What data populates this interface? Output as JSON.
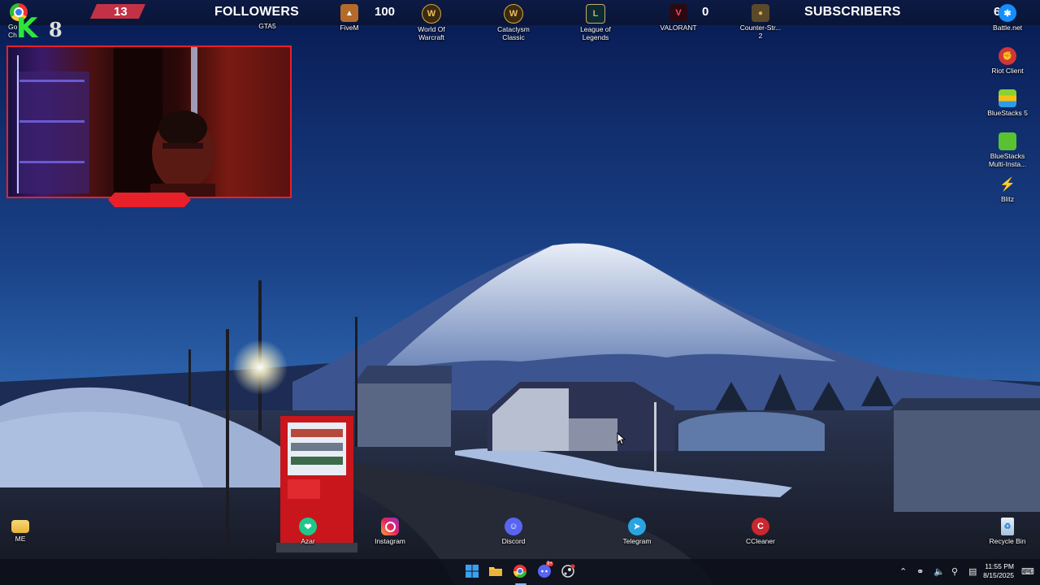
{
  "overlay": {
    "followers_count": "13",
    "followers_label": "FOLLOWERS",
    "score_100": "100",
    "score_0": "0",
    "subscribers_label": "SUBSCRIBERS",
    "subscribers_count": "6",
    "logo_letter": "K",
    "logo_number": "8"
  },
  "desktop_icons_top": [
    {
      "label": "Go\nCh",
      "icon": "chrome-icon"
    },
    {
      "label": "GTA5",
      "icon": "gta5-icon"
    },
    {
      "label": "FiveM",
      "icon": "fivem-icon"
    },
    {
      "label": "World Of\nWarcraft",
      "icon": "wow-icon"
    },
    {
      "label": "Cataclysm\nClassic",
      "icon": "wow-classic-icon"
    },
    {
      "label": "League of\nLegends",
      "icon": "league-icon"
    },
    {
      "label": "VALORANT",
      "icon": "valorant-icon"
    },
    {
      "label": "Counter-Str...\n2",
      "icon": "cs2-icon"
    },
    {
      "label": "Battle.net",
      "icon": "battlenet-icon"
    }
  ],
  "desktop_icons_right": [
    {
      "label": "Riot Client",
      "icon": "riot-icon"
    },
    {
      "label": "BlueStacks 5",
      "icon": "bluestacks-icon"
    },
    {
      "label": "BlueStacks\nMulti-Insta...",
      "icon": "bluestacks-multi-icon"
    },
    {
      "label": "Blitz",
      "icon": "blitz-icon"
    }
  ],
  "desktop_icons_bottom": [
    {
      "label": "ME",
      "icon": "folder-icon"
    },
    {
      "label": "Azar",
      "icon": "azar-icon"
    },
    {
      "label": "Instagram",
      "icon": "instagram-icon"
    },
    {
      "label": "Discord",
      "icon": "discord-icon"
    },
    {
      "label": "Telegram",
      "icon": "telegram-icon"
    },
    {
      "label": "CCleaner",
      "icon": "ccleaner-icon"
    },
    {
      "label": "Recycle Bin",
      "icon": "recycle-bin-icon"
    }
  ],
  "taskbar": {
    "pinned": [
      "windows-start-icon",
      "file-explorer-icon",
      "chrome-icon",
      "discord-icon",
      "steam-icon"
    ],
    "discord_badge": "9+",
    "tray_icons": [
      "chevron-up-icon",
      "headset-icon",
      "volume-icon",
      "microphone-icon",
      "network-icon",
      "notification-icon"
    ],
    "time": "11:55 PM",
    "date": "8/15/2025"
  },
  "colors": {
    "overlay_accent": "#c23246",
    "webcam_border": "#e8202a",
    "logo_green": "#2ee63a",
    "sky_top": "#0a1f5c",
    "sky_bottom": "#2b5fa8"
  }
}
